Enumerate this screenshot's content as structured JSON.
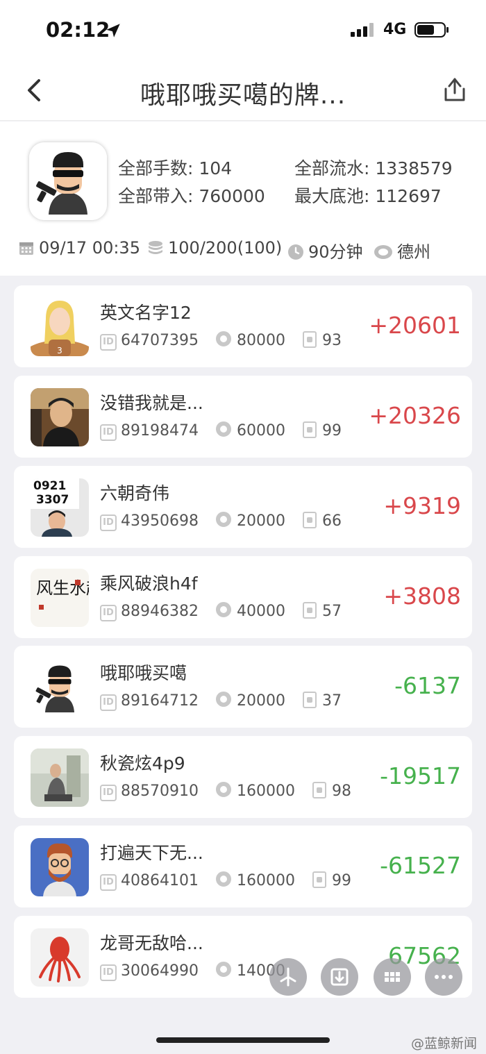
{
  "status_bar": {
    "time": "02:12",
    "network": "4G"
  },
  "nav": {
    "title": "哦耶哦买噶的牌..."
  },
  "summary": {
    "hands_label": "全部手数: 104",
    "flow_label": "全部流水: 1338579",
    "buyin_label": "全部带入: 760000",
    "pot_label": "最大底池: 112697"
  },
  "meta": {
    "datetime": "09/17 00:35",
    "blinds": "100/200(100)",
    "duration": "90分钟",
    "game": "德州"
  },
  "players": [
    {
      "name": "英文名字12",
      "id": "64707395",
      "buyin": "80000",
      "hands": "93",
      "score": "+20601",
      "positive": true
    },
    {
      "name": "没错我就是...",
      "id": "89198474",
      "buyin": "60000",
      "hands": "99",
      "score": "+20326",
      "positive": true
    },
    {
      "name": "六朝奇伟",
      "id": "43950698",
      "buyin": "20000",
      "hands": "66",
      "score": "+9319",
      "positive": true
    },
    {
      "name": "乘风破浪h4f",
      "id": "88946382",
      "buyin": "40000",
      "hands": "57",
      "score": "+3808",
      "positive": true
    },
    {
      "name": "哦耶哦买噶",
      "id": "89164712",
      "buyin": "20000",
      "hands": "37",
      "score": "-6137",
      "positive": false
    },
    {
      "name": "秋瓷炫4p9",
      "id": "88570910",
      "buyin": "160000",
      "hands": "98",
      "score": "-19517",
      "positive": false
    },
    {
      "name": "打遍天下无...",
      "id": "40864101",
      "buyin": "160000",
      "hands": "99",
      "score": "-61527",
      "positive": false
    },
    {
      "name": "龙哥无敌哈...",
      "id": "30064990",
      "buyin": "14000",
      "hands": "",
      "score": "67562",
      "positive": false
    }
  ],
  "avatar_labels": {
    "first_badge": "3",
    "plate_line1": "0921",
    "plate_line2": "3307",
    "calligraphy": "风生水起"
  },
  "watermark": "@蓝鲸新闻",
  "colors": {
    "positive": "#d9474b",
    "negative": "#46b14d",
    "background": "#f0f0f4"
  }
}
